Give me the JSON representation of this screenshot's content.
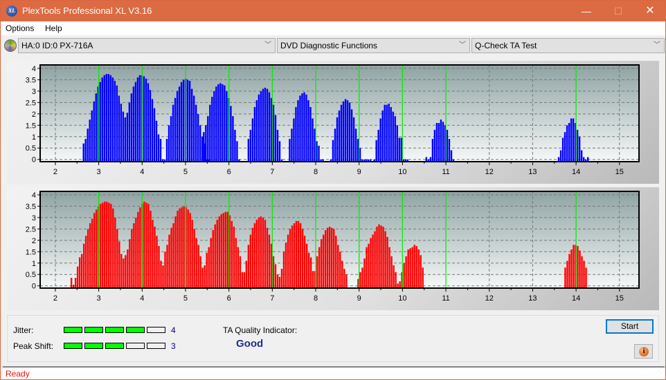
{
  "window": {
    "title": "PlexTools Professional XL V3.16",
    "icon_label": "XL",
    "minimize_glyph": "—",
    "maximize_glyph": "☐",
    "close_glyph": "✕"
  },
  "menu": {
    "items": [
      {
        "label": "Options"
      },
      {
        "label": "Help"
      }
    ]
  },
  "toolbar": {
    "drive": "HA:0 ID:0  PX-716A",
    "function": "DVD Diagnostic Functions",
    "test": "Q-Check TA Test",
    "arrow": "﹀"
  },
  "results": {
    "jitter_label": "Jitter:",
    "jitter_value": "4",
    "jitter_level": 4,
    "peak_shift_label": "Peak Shift:",
    "peak_shift_value": "3",
    "peak_shift_level": 3,
    "meter_max": 5,
    "ta_quality_label": "TA Quality Indicator:",
    "ta_quality_value": "Good"
  },
  "buttons": {
    "start": "Start",
    "info": "i"
  },
  "status": {
    "text": "Ready"
  },
  "colors": {
    "title_bar": "#dc6a42",
    "blue_series": "#0000ff",
    "red_series": "#ff0000",
    "marker": "#00ee00",
    "meter_on": "#00ff00",
    "status_text": "#e81010"
  },
  "chart_data": [
    {
      "type": "bar",
      "name": "top-chart",
      "series_color": "#0000ff",
      "xlim": [
        1.65,
        15.45
      ],
      "ylim": [
        -0.1,
        4.15
      ],
      "x_ticks": [
        2,
        3,
        4,
        5,
        6,
        7,
        8,
        9,
        10,
        11,
        12,
        13,
        14,
        15
      ],
      "y_ticks": [
        0,
        0.5,
        1,
        1.5,
        2,
        2.5,
        3,
        3.5,
        4
      ],
      "y_tick_labels": [
        "0",
        "0.5",
        "1",
        "1.5",
        "2",
        "2.5",
        "3",
        "3.5",
        "4"
      ],
      "grid": true,
      "markers": [
        3,
        4,
        5,
        6,
        7,
        8,
        9,
        10,
        11,
        14
      ],
      "bar_step": 0.048,
      "segments": [
        {
          "start": 2.65,
          "values": [
            0.7,
            0.9,
            1.35,
            1.75,
            2.15,
            2.55,
            2.9,
            3.2,
            3.4,
            3.6,
            3.7,
            3.75,
            3.75,
            3.7,
            3.6,
            3.45,
            3.25,
            2.8,
            2.45,
            2.1,
            1.85,
            2.05,
            2.5,
            2.9,
            3.2,
            3.4,
            3.6,
            3.7,
            3.7,
            3.65,
            3.55,
            3.35,
            3.05,
            2.65,
            2.25,
            1.7,
            1.1,
            0.9,
            0,
            0,
            0.9,
            1.5,
            1.9,
            2.4,
            2.7,
            3.0,
            3.2,
            3.4,
            3.5,
            3.55,
            3.5,
            3.45,
            3.1,
            2.8,
            2.4,
            2.0,
            1.5,
            1.0,
            0.7,
            0,
            0
          ]
        },
        {
          "start": 5.42,
          "values": [
            1.2,
            1.5,
            1.9,
            2.4,
            2.75,
            3.0,
            3.2,
            3.3,
            3.35,
            3.3,
            3.25,
            3.0,
            2.7,
            2.35,
            1.9,
            1.3,
            0.8,
            0
          ]
        },
        {
          "start": 6.45,
          "values": [
            0.9,
            1.3,
            1.8,
            2.3,
            2.6,
            2.85,
            3.0,
            3.1,
            3.15,
            3.1,
            2.95,
            2.7,
            2.4,
            1.95,
            1.3,
            0.8,
            0
          ]
        },
        {
          "start": 7.4,
          "values": [
            0.9,
            1.35,
            1.8,
            2.3,
            2.6,
            2.8,
            2.9,
            2.95,
            2.85,
            2.6,
            2.3,
            1.8,
            1.35,
            0.8,
            0.6,
            0,
            0
          ]
        },
        {
          "start": 8.35,
          "values": [
            0,
            0.85,
            1.35,
            1.85,
            2.15,
            2.4,
            2.55,
            2.65,
            2.6,
            2.5,
            2.2,
            1.85,
            1.35,
            0.9,
            0.5,
            0,
            0,
            0,
            0,
            0
          ]
        },
        {
          "start": 9.35,
          "values": [
            0,
            0.85,
            1.3,
            1.8,
            2.15,
            2.4,
            2.4,
            2.45,
            2.3,
            2.1,
            1.9,
            1.5,
            0.95,
            0.95,
            0,
            0,
            0
          ]
        },
        {
          "start": 10.55,
          "values": [
            0.1,
            0,
            0.1,
            0.9,
            1.3,
            1.6,
            1.6,
            1.75,
            1.65,
            1.5,
            1.3,
            0.9,
            0.4,
            0
          ]
        },
        {
          "start": 13.6,
          "values": [
            0.1,
            0.4,
            0.95,
            1.2,
            1.5,
            1.6,
            1.8,
            1.8,
            1.6,
            1.3,
            1.0,
            0.4,
            0.1,
            0,
            0.1
          ]
        }
      ]
    },
    {
      "type": "bar",
      "name": "bottom-chart",
      "series_color": "#ff0000",
      "xlim": [
        1.65,
        15.45
      ],
      "ylim": [
        -0.1,
        4.15
      ],
      "x_ticks": [
        2,
        3,
        4,
        5,
        6,
        7,
        8,
        9,
        10,
        11,
        12,
        13,
        14,
        15
      ],
      "y_ticks": [
        0,
        0.5,
        1,
        1.5,
        2,
        2.5,
        3,
        3.5,
        4
      ],
      "y_tick_labels": [
        "0",
        "0.5",
        "1",
        "1.5",
        "2",
        "2.5",
        "3",
        "3.5",
        "4"
      ],
      "grid": true,
      "markers": [
        3,
        4,
        5,
        6,
        7,
        8,
        9,
        10,
        11,
        14
      ],
      "bar_step": 0.048,
      "segments": [
        {
          "start": 2.37,
          "values": [
            0.35,
            0.05,
            0.35,
            0.85,
            1.25,
            1.4,
            1.85,
            2.2,
            2.5,
            2.75,
            2.95,
            3.2,
            3.35,
            3.5,
            3.6,
            3.65,
            3.7,
            3.7,
            3.65,
            3.6,
            3.4,
            3.0,
            2.5,
            1.95,
            1.4,
            1.2,
            1.35,
            1.6,
            2.05,
            2.5,
            2.75,
            3.0,
            3.25,
            3.45,
            3.6,
            3.7,
            3.65,
            3.6,
            3.3,
            2.9,
            2.6,
            2.2,
            1.75,
            1.1,
            0.9,
            1.5,
            1.8,
            2.25,
            2.55,
            2.75,
            3.05,
            3.3,
            3.4,
            3.45,
            3.5,
            3.45,
            3.35,
            3.2,
            2.9,
            2.5,
            2.1,
            1.8,
            1.3,
            0.8,
            0.9,
            1.45,
            1.7,
            2.1,
            2.45,
            2.7,
            2.9,
            3.05,
            3.15,
            3.2,
            3.25,
            3.25,
            3.1,
            2.85,
            2.6,
            2.1,
            1.7,
            1.3,
            0.6,
            0.6,
            1.1,
            1.8,
            2.25,
            2.55,
            2.75,
            2.9,
            3.0,
            3.05,
            3.0,
            2.9,
            2.55,
            2.25,
            1.85,
            1.3,
            0.95,
            0.5,
            0.4,
            0.75,
            1.5,
            1.9,
            2.25,
            2.5,
            2.65,
            2.75,
            2.85,
            2.85,
            2.75,
            2.5,
            2.2,
            1.85,
            1.45,
            1.25,
            0.65,
            0.65,
            1.3,
            1.7,
            2.05,
            2.25,
            2.45,
            2.55,
            2.6,
            2.55,
            2.5,
            2.2,
            1.8,
            1.5,
            1.1,
            0.75,
            0.5
          ]
        },
        {
          "start": 8.98,
          "values": [
            0.3,
            0.6,
            0.8,
            1.2,
            1.7,
            1.85,
            2.1,
            2.25,
            2.4,
            2.6,
            2.7,
            2.65,
            2.6,
            2.4,
            2.15,
            1.7,
            1.3,
            0.9,
            0.6,
            0.1,
            0.2,
            0.6,
            1.0,
            1.3,
            1.6,
            1.65,
            1.7,
            1.8,
            1.75,
            1.6,
            1.35,
            0.8
          ]
        },
        {
          "start": 13.75,
          "values": [
            0.8,
            1.1,
            1.4,
            1.6,
            1.8,
            1.8,
            1.75,
            1.55,
            1.3,
            1.1,
            0.8
          ]
        }
      ]
    }
  ]
}
